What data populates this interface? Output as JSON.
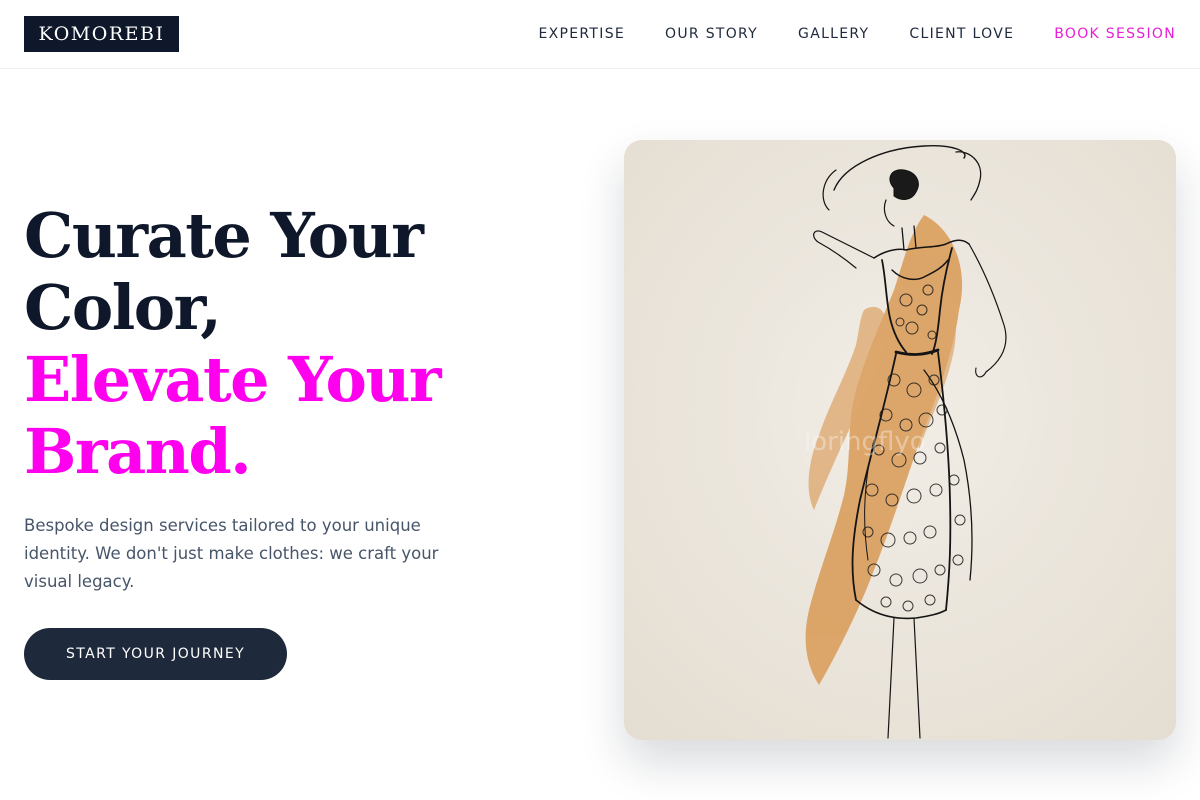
{
  "header": {
    "logo_text": "KOMOREBI",
    "nav": [
      {
        "label": "EXPERTISE"
      },
      {
        "label": "OUR STORY"
      },
      {
        "label": "GALLERY"
      },
      {
        "label": "CLIENT LOVE"
      },
      {
        "label": "BOOK SESSION"
      }
    ]
  },
  "hero": {
    "headline": {
      "line1": "Curate Your",
      "line2": "Color,",
      "line3": "Elevate Your",
      "line4": "Brand."
    },
    "subcopy": "Bespoke design services tailored to your unique identity. We don't just make clothes: we craft your visual legacy.",
    "cta_label": "START YOUR JOURNEY"
  },
  "colors": {
    "primary": "#0f172a",
    "accent": "#ff00ee",
    "nav_accent": "#e91ed6",
    "button": "#1e293b"
  },
  "illustration": {
    "subject": "fashion-sketch-dress-figure",
    "watermark": "loringflyo"
  }
}
